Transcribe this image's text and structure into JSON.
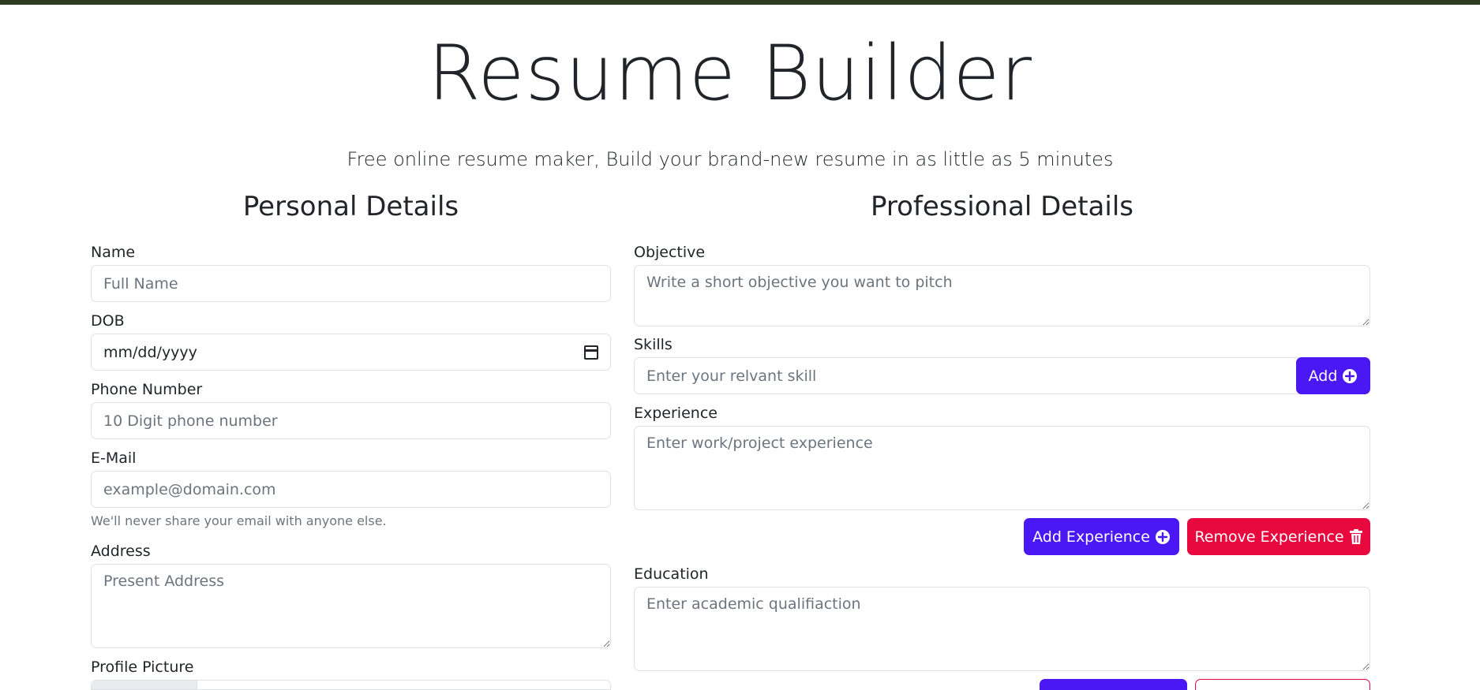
{
  "header": {
    "title": "Resume Builder",
    "subtitle": "Free online resume maker, Build your brand-new resume in as little as 5 minutes"
  },
  "colors": {
    "topbar": "#2e3b22",
    "primary": "#4a17f5",
    "danger": "#e8083e"
  },
  "personal": {
    "heading": "Personal Details",
    "name": {
      "label": "Name",
      "placeholder": "Full Name"
    },
    "dob": {
      "label": "DOB",
      "value": "mm/dd/yyyy",
      "icon": "calendar-icon"
    },
    "phone": {
      "label": "Phone Number",
      "placeholder": "10 Digit phone number"
    },
    "email": {
      "label": "E-Mail",
      "placeholder": "example@domain.com",
      "help": "We'll never share your email with anyone else."
    },
    "address": {
      "label": "Address",
      "placeholder": "Present Address"
    },
    "picture": {
      "label": "Profile Picture"
    }
  },
  "professional": {
    "heading": "Professional Details",
    "objective": {
      "label": "Objective",
      "placeholder": "Write a short objective you want to pitch"
    },
    "skills": {
      "label": "Skills",
      "placeholder": "Enter your relvant skill",
      "add_label": "Add",
      "add_icon": "plus-circle-icon"
    },
    "experience": {
      "label": "Experience",
      "placeholder": "Enter work/project experience",
      "add_label": "Add Experience",
      "add_icon": "plus-circle-icon",
      "remove_label": "Remove Experience",
      "remove_icon": "trash-icon"
    },
    "education": {
      "label": "Education",
      "placeholder": "Enter academic qualifiaction"
    }
  }
}
